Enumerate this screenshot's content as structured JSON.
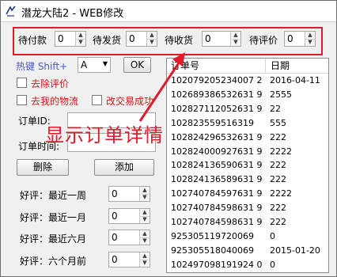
{
  "window": {
    "title": "潜龙大陆2  -  WEB修改"
  },
  "top_fields": [
    {
      "label": "待付款",
      "value": "0"
    },
    {
      "label": "待发货",
      "value": "0"
    },
    {
      "label": "待收货",
      "value": "0"
    },
    {
      "label": "待评价",
      "value": "0"
    }
  ],
  "hotkey": {
    "label": "热键 Shift+",
    "key": "A",
    "ok": "OK"
  },
  "checks": {
    "remove_review": "去除评价",
    "remove_logistics": "去我的物流",
    "change_trade": "改交易成功"
  },
  "order": {
    "id_label": "订单ID:",
    "time_label": "订单时间:",
    "delete": "删除",
    "add": "添加"
  },
  "overlay_text": "显示订单详情",
  "reviews": [
    {
      "label": "好评：最近一周",
      "value": "0"
    },
    {
      "label": "好评：最近一月",
      "value": "0"
    },
    {
      "label": "好评：最近六月",
      "value": "0"
    },
    {
      "label": "好评：六个月前",
      "value": "0"
    }
  ],
  "table": {
    "headers": [
      "订单号",
      "日期"
    ],
    "rows": [
      [
        "102079205234007 2",
        "2016-04-11"
      ],
      [
        "102689386532631 9",
        "2555"
      ],
      [
        "102827112052631 9",
        "22"
      ],
      [
        "102823559516319",
        "555"
      ],
      [
        "102824296532631 9",
        "222"
      ],
      [
        "102824000927631 9",
        "2222"
      ],
      [
        "102824136590631 9",
        "222"
      ],
      [
        "102824136589631 9",
        "222"
      ],
      [
        "102740784597631 9",
        "2222"
      ],
      [
        "102740784598631 9",
        "222"
      ],
      [
        "102740784598631 9",
        "222"
      ],
      [
        "925305119720069",
        "0"
      ],
      [
        "925305518040069",
        "2015-01-20"
      ],
      [
        "102497098191924 0",
        "0"
      ]
    ]
  }
}
